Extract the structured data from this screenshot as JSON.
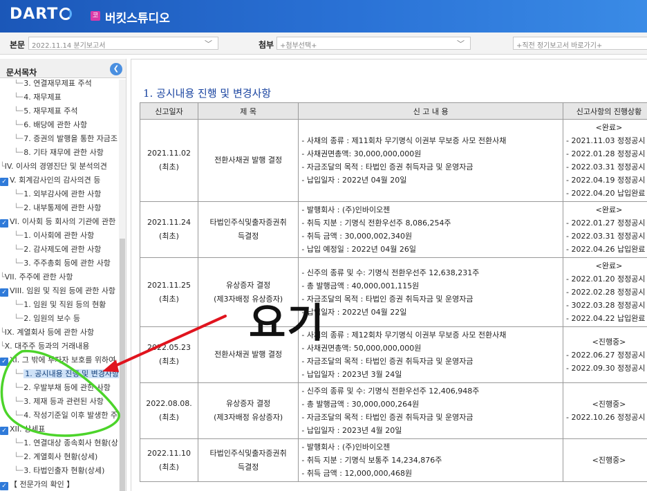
{
  "header": {
    "logo": "DART",
    "company_badge": "코",
    "company_name": "버킷스튜디오"
  },
  "toolbar": {
    "main_label": "본문",
    "main_value": "2022.11.14  분기보고서",
    "attach_label": "첨부",
    "attach_value": "+첨부선택+",
    "shortcut_value": "+직전 정기보고서 바로가기+"
  },
  "sidebar": {
    "title": "문서목차",
    "items": [
      "3. 연결재무제표 주석",
      "4. 재무제표",
      "5. 재무제표 주석",
      "6. 배당에 관한 사항",
      "7. 증권의 발행을 통한 자금조",
      "8. 기타 재무에 관한 사항",
      "IV. 이사의 경영진단 및 분석의견",
      "V. 회계감사인의 감사의견 등",
      "1. 외부감사에 관한 사항",
      "2. 내부통제에 관한 사항",
      "VI. 이사회 등 회사의 기관에 관한",
      "1. 이사회에 관한 사항",
      "2. 감사제도에 관한 사항",
      "3. 주주총회 등에 관한 사항",
      "VII. 주주에 관한 사항",
      "VIII. 임원 및 직원 등에 관한 사항",
      "1. 임원 및 직원 등의 현황",
      "2. 임원의 보수 등",
      "IX. 계열회사 등에 관한 사항",
      "X. 대주주 등과의 거래내용",
      "XI. 그 밖에 투자자 보호를 위하여",
      "1. 공시내용 진행 및 변경사항",
      "2. 우발부채 등에 관한 사항",
      "3. 제재 등과 관련된 사항",
      "4. 작성기준일 이후 발생한 주",
      "XII. 상세표",
      "1. 연결대상 종속회사 현황(상",
      "2. 계열회사 현황(상세)",
      "3. 타법인출자 현황(상세)",
      "【 전문가의 확인 】"
    ]
  },
  "content": {
    "title": "1. 공시내용 진행 및 변경사항",
    "columns": [
      "신고일자",
      "제 목",
      "신 고 내 용",
      "신고사항의 진행상황"
    ],
    "rows": [
      {
        "date": "2021.11.02",
        "date_note": "(최초)",
        "name": [
          "전환사채권 발행 결정"
        ],
        "details": [
          "- 사채의 종류 : 제11회차 무기명식 이권부 무보증 사모 전환사채",
          "- 사채권면총액: 30,000,000,000원",
          "- 자금조달의 목적 : 타법인 증권 취득자금 및 운영자금",
          "- 납입일자 : 2022년 04월 20일"
        ],
        "status_head": "<완료>",
        "status": [
          "- 2021.11.03 정정공시",
          "- 2022.01.28 정정공시",
          "- 2022.03.31 정정공시",
          "- 2022.04.19 정정공시",
          "- 2022.04.20 납입완료"
        ]
      },
      {
        "date": "2021.11.24",
        "date_note": "(최초)",
        "name": [
          "타법인주식및출자증권취",
          "득결정"
        ],
        "details": [
          "- 발행회사 : (주)인바이오젠",
          "- 취득 지분 : 기명식 전환우선주 8,086,254주",
          "- 취득 금액 : 30,000,002,340원",
          "- 납입 예정일 : 2022년 04월 26일"
        ],
        "status_head": "<완료>",
        "status": [
          "- 2022.01.27 정정공시",
          "- 2022.03.31 정정공시",
          "- 2022.04.26 납입완료"
        ]
      },
      {
        "date": "2021.11.25",
        "date_note": "(최초)",
        "name": [
          "유상증자 결정",
          "(제3자배정 유상증자)"
        ],
        "details": [
          "- 신주의 종류 및 수: 기명식 전환우선주 12,638,231주",
          "- 총 발행금액 : 40,000,001,115원",
          "- 자금조달의 목적 : 타법인 증권 취득자금 및 운영자금",
          "- 납입일자 : 2022년 04월 22일"
        ],
        "status_head": "<완료>",
        "status": [
          "- 2022.01.20 정정공시",
          "- 2022.02.28 정정공시",
          "- 3022.03.28 정정공시",
          "- 2022.04.22 납입완료"
        ]
      },
      {
        "date": "2022.05.23",
        "date_note": "(최초)",
        "name": [
          "전환사채권 발행 결정"
        ],
        "details": [
          "- 사채의 종류 : 제12회차 무기명식 이권부 무보증 사모 전환사채",
          "- 사채권면총액: 50,000,000,000원",
          "- 자금조달의 목적 : 타법인 증권 취득자금 및 운영자금",
          "- 납입일자 : 2023년 3월 24일"
        ],
        "status_head": "<진행중>",
        "status": [
          "- 2022.06.27 정정공시",
          "- 2022.09.30 정정공시"
        ]
      },
      {
        "date": "2022.08.08.",
        "date_note": "(최초)",
        "name": [
          "유상증자 결정",
          "(제3자배정 유상증자)"
        ],
        "details": [
          "- 신주의 종류 및 수: 기명식 전환우선주 12,406,948주",
          "- 총 발행금액 : 30,000,000,264원",
          "- 자금조달의 목적 : 타법인 증권 취득자금 및 운영자금",
          "- 납입일자 : 2023년 4월 20일"
        ],
        "status_head": "<진행중>",
        "status": [
          "- 2022.10.26 정정공시"
        ]
      },
      {
        "date": "2022.11.10",
        "date_note": "(최초)",
        "name": [
          "타법인주식및출자증권취",
          "득결정"
        ],
        "details": [
          "- 발행회사 : (주)인바이오젠",
          "- 취득 지분 : 기명식 보통주 14,234,876주",
          "- 취득 금액 : 12,000,000,468원"
        ],
        "status_head": "<진행중>",
        "status": []
      }
    ]
  },
  "annotation": {
    "text": "요기",
    "arrow_color": "#e0141e",
    "circle_color": "#4cd42a"
  }
}
